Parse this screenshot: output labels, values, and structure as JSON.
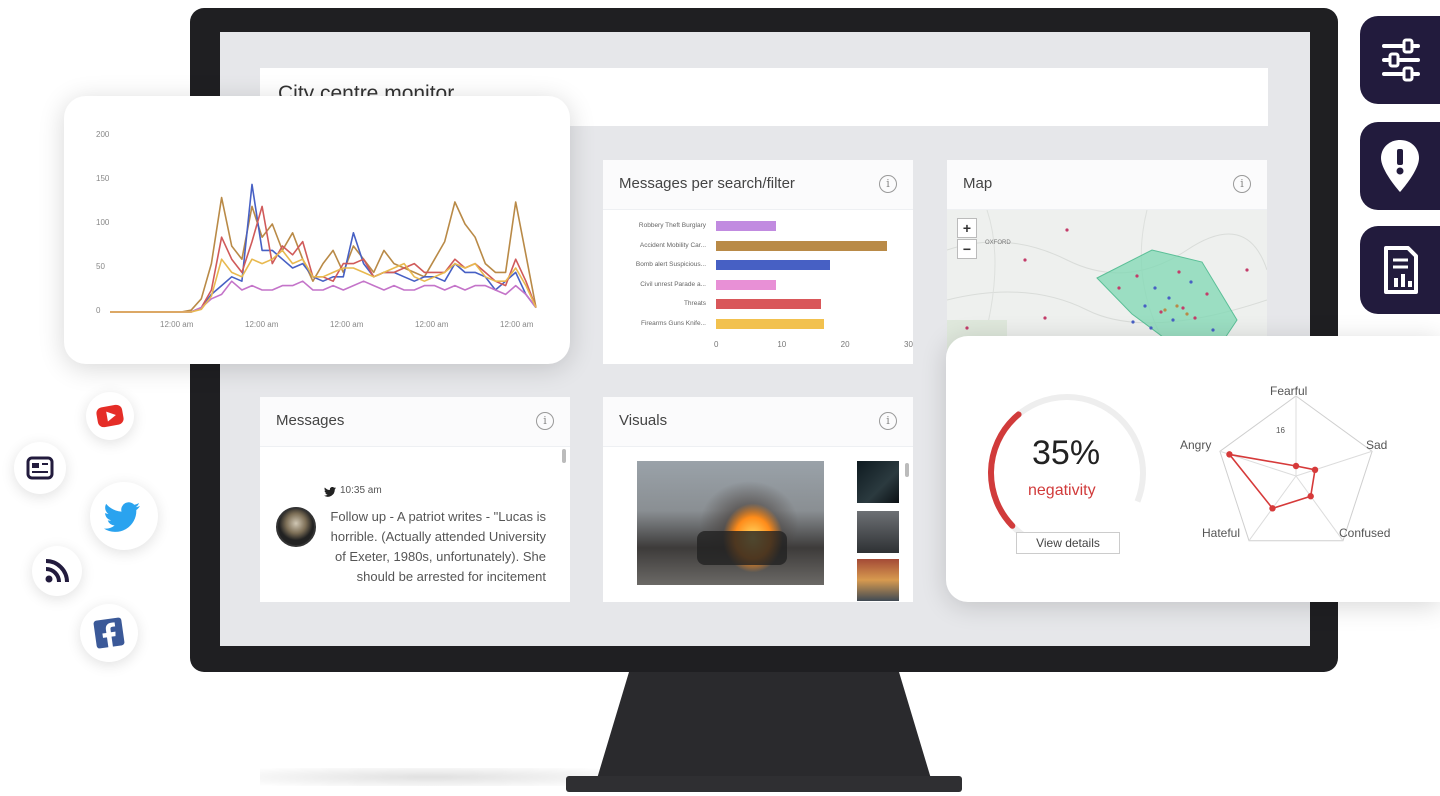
{
  "dashboard": {
    "title": "City centre monitor"
  },
  "messages_per_filter": {
    "title": "Messages per search/filter",
    "info_icon": "i"
  },
  "map": {
    "title": "Map",
    "info_icon": "i",
    "zoom_in": "+",
    "zoom_out": "−",
    "town_label": "OXFORD"
  },
  "messages": {
    "title": "Messages",
    "info_icon": "i",
    "time": "10:35 am",
    "text": "Follow up - A patriot writes - \"Lucas is horrible. (Actually attended University of Exeter, 1980s, unfortunately). She should be arrested for incitement"
  },
  "visuals": {
    "title": "Visuals",
    "info_icon": "i"
  },
  "emotions": {
    "percent": "35%",
    "label": "negativity",
    "button": "View details",
    "radar_labels": [
      "Fearful",
      "Sad",
      "Confused",
      "Hateful",
      "Angry"
    ],
    "radar_scale": "16"
  },
  "colors": {
    "screen_bg": "#e6e7ea",
    "accent_dark": "#221b3d",
    "negativity_red": "#d13b3b"
  },
  "icons": {
    "side_buttons": [
      "sliders-icon",
      "alert-pin-icon",
      "report-icon"
    ],
    "social": [
      "youtube-icon",
      "news-icon",
      "twitter-icon",
      "rss-icon",
      "facebook-icon"
    ]
  },
  "chart_data": [
    {
      "type": "line",
      "title": "",
      "xlabel": "",
      "ylabel": "",
      "ylim": [
        0,
        200
      ],
      "y_ticks": [
        "200",
        "150",
        "100",
        "50",
        "0"
      ],
      "x_ticks": [
        "12:00 am",
        "12:00 am",
        "12:00 am",
        "12:00 am",
        "12:00 am"
      ],
      "grid": false,
      "series": [
        {
          "color": "#b98a47",
          "values": [
            0,
            0,
            0,
            0,
            0,
            0,
            0,
            0,
            2,
            15,
            55,
            130,
            75,
            60,
            120,
            85,
            100,
            70,
            90,
            60,
            35,
            55,
            70,
            45,
            75,
            60,
            45,
            70,
            55,
            50,
            45,
            40,
            60,
            80,
            125,
            100,
            85,
            55,
            45,
            45,
            125,
            65,
            5
          ]
        },
        {
          "color": "#4760c4",
          "values": [
            0,
            0,
            0,
            0,
            0,
            0,
            0,
            0,
            0,
            5,
            20,
            30,
            40,
            35,
            145,
            70,
            70,
            60,
            50,
            55,
            40,
            35,
            40,
            40,
            90,
            55,
            40,
            45,
            45,
            40,
            35,
            40,
            40,
            35,
            55,
            45,
            45,
            40,
            25,
            35,
            45,
            20,
            5
          ]
        },
        {
          "color": "#d05a5a",
          "values": [
            0,
            0,
            0,
            0,
            0,
            0,
            0,
            0,
            0,
            5,
            25,
            85,
            60,
            45,
            80,
            120,
            55,
            75,
            65,
            80,
            40,
            40,
            35,
            55,
            55,
            60,
            40,
            45,
            45,
            50,
            55,
            45,
            45,
            45,
            60,
            50,
            55,
            45,
            35,
            30,
            60,
            35,
            5
          ]
        },
        {
          "color": "#c474c9",
          "values": [
            0,
            0,
            0,
            0,
            0,
            0,
            0,
            0,
            0,
            5,
            15,
            20,
            35,
            25,
            30,
            25,
            25,
            30,
            30,
            35,
            25,
            25,
            30,
            25,
            30,
            35,
            30,
            25,
            30,
            25,
            25,
            30,
            30,
            25,
            30,
            25,
            30,
            30,
            25,
            20,
            30,
            20,
            5
          ]
        },
        {
          "color": "#e8b94f",
          "values": [
            0,
            0,
            0,
            0,
            0,
            0,
            0,
            0,
            0,
            3,
            18,
            60,
            45,
            40,
            60,
            55,
            60,
            70,
            55,
            60,
            40,
            40,
            45,
            50,
            50,
            45,
            40,
            45,
            50,
            55,
            40,
            35,
            40,
            45,
            55,
            50,
            55,
            40,
            35,
            35,
            50,
            30,
            5
          ]
        }
      ]
    },
    {
      "type": "bar",
      "orientation": "horizontal",
      "title": "Messages per search/filter",
      "categories": [
        "Robbery Theft Burglary",
        "Accident Mobility Car...",
        "Bomb alert Suspicious...",
        "Civil unrest Parade a...",
        "Threats",
        "Firearms Guns Knife..."
      ],
      "values": [
        9.5,
        27,
        18,
        9.5,
        16.5,
        17
      ],
      "colors": [
        "#c18be0",
        "#b98a47",
        "#4760c4",
        "#e890d6",
        "#d9575a",
        "#f2c14e"
      ],
      "x_ticks": [
        "0",
        "10",
        "20",
        "30"
      ],
      "xlim": [
        0,
        30
      ]
    },
    {
      "type": "radar",
      "title": "",
      "categories": [
        "Fearful",
        "Sad",
        "Confused",
        "Hateful",
        "Angry"
      ],
      "values": [
        2,
        4,
        5,
        8,
        14
      ],
      "scale_label": "16",
      "rmax": 16
    }
  ]
}
